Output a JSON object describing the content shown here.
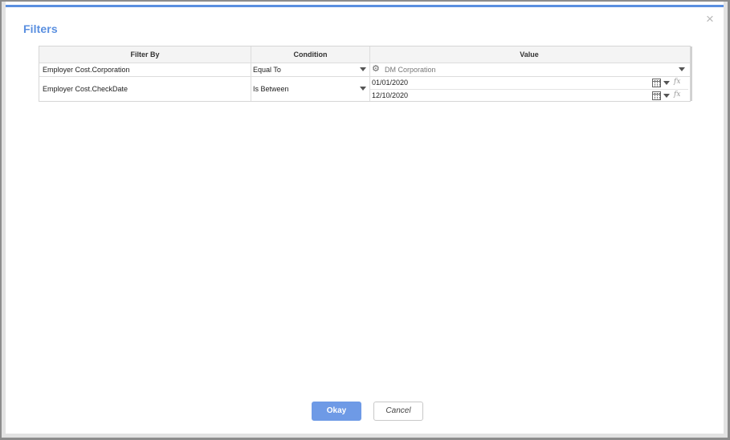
{
  "dialog": {
    "title": "Filters",
    "close_glyph": "×"
  },
  "grid": {
    "headers": [
      "Filter By",
      "Condition",
      "Value"
    ],
    "rows": [
      {
        "filter_by": "Employer Cost.Corporation",
        "condition": "Equal To",
        "value": "DM Corporation",
        "value_icon": "gear-icon"
      },
      {
        "filter_by": "Employer Cost.CheckDate",
        "condition": "Is Between",
        "value_from": "01/01/2020",
        "value_to": "12/10/2020"
      }
    ],
    "fx_label": "fx"
  },
  "buttons": {
    "okay": "Okay",
    "cancel": "Cancel"
  },
  "colors": {
    "accent": "#5a8fe0",
    "okay_button": "#6e9ae6"
  }
}
